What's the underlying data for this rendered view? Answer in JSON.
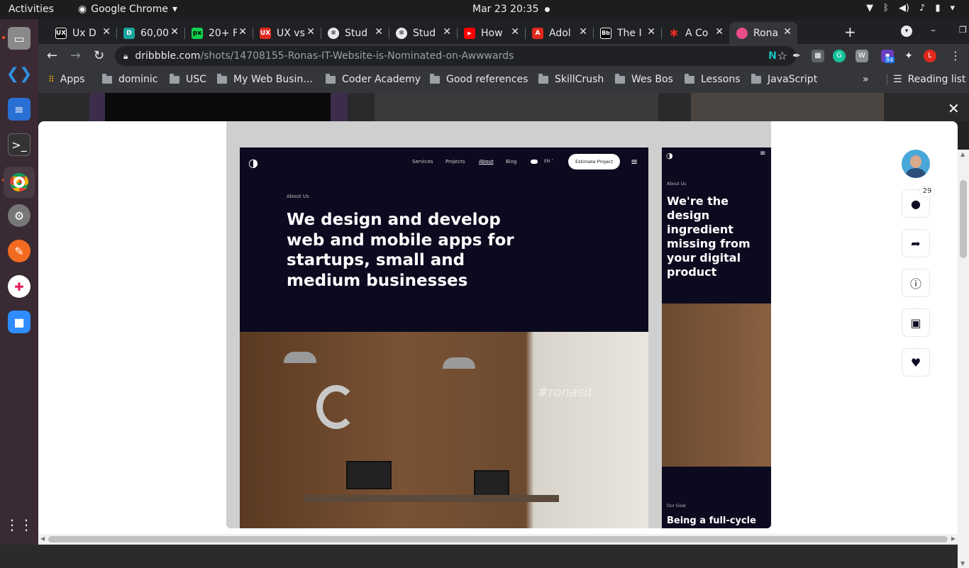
{
  "system": {
    "activities": "Activities",
    "app_name": "Google Chrome",
    "clock": "Mar 23  20:35"
  },
  "tabs": [
    {
      "label": "Ux D",
      "icon": "UX",
      "color": "#000000"
    },
    {
      "label": "60,00",
      "icon": "D",
      "color": "#1ba39c"
    },
    {
      "label": "20+ F",
      "icon": "px",
      "color": "#0fd14f"
    },
    {
      "label": "UX vs",
      "icon": "UX",
      "color": "#e0291e"
    },
    {
      "label": "Stud",
      "icon": "✻",
      "color": "#e8eaed"
    },
    {
      "label": "Stud",
      "icon": "✻",
      "color": "#e8eaed"
    },
    {
      "label": "How",
      "icon": "▶",
      "color": "#ff0000"
    },
    {
      "label": "Adol",
      "icon": "A",
      "color": "#e0291e"
    },
    {
      "label": "The I",
      "icon": "Bb",
      "color": "#000000"
    },
    {
      "label": "A Co",
      "icon": "✱",
      "color": "#e0291e"
    },
    {
      "label": "Rona",
      "icon": "",
      "color": "#ea4c89"
    }
  ],
  "omnibox": {
    "host": "dribbble.com",
    "path": "/shots/14708155-Ronas-IT-Website-is-Nominated-on-Awwwards"
  },
  "extensions": {
    "badge_count": "84",
    "profile_letter": "L"
  },
  "bookmarks": {
    "apps": "Apps",
    "items": [
      "dominic",
      "USC",
      "My Web Busin...",
      "Coder Academy",
      "Good references",
      "SkillCrush",
      "Wes Bos",
      "Lessons",
      "JavaScript"
    ],
    "more": "»",
    "reading_list": "Reading list"
  },
  "shot": {
    "desktop": {
      "nav": [
        "Services",
        "Projects",
        "About",
        "Blog"
      ],
      "lang": "EN ˅",
      "cta": "Estimate Project",
      "kicker": "About Us",
      "headline": "We design and develop web and mobile apps for startups, small and medium businesses",
      "brand_sign": "#ronasit"
    },
    "mobile": {
      "kicker": "About Us",
      "headline": "We're the design ingredient missing from your digital product",
      "goal_kicker": "Our Goal",
      "goal_text": "Being a full-cycle"
    }
  },
  "actions": {
    "comment_count": "29"
  },
  "colors": {
    "accent": "#ea4c89",
    "shot_bg": "#0c0a1f",
    "ubuntu_orange": "#e95420"
  }
}
